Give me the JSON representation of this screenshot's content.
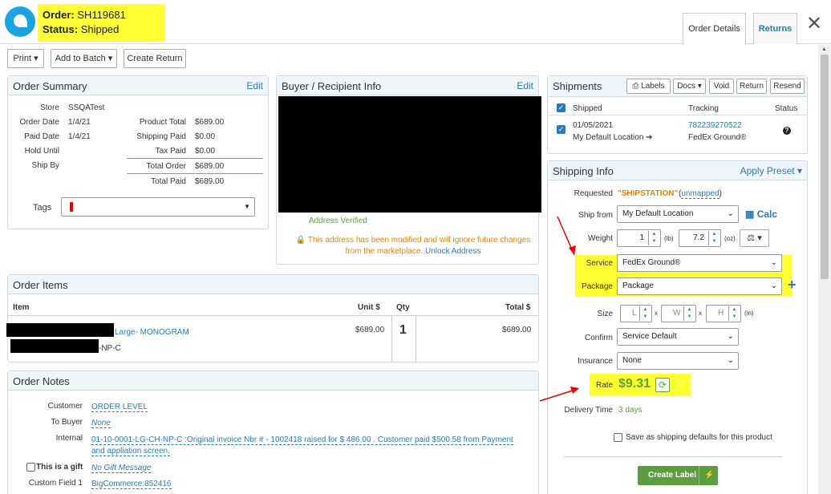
{
  "header": {
    "order_label": "Order:",
    "order_number": "SH119681",
    "status_label": "Status:",
    "status_value": "Shipped",
    "close_glyph": "✕",
    "logo_icon": "shipstation-logo"
  },
  "tabs": [
    {
      "label": "Order Details"
    },
    {
      "label": "Returns"
    }
  ],
  "toolbar": {
    "print": "Print",
    "add_to_batch": "Add to Batch",
    "create_return": "Create Return"
  },
  "order_summary": {
    "title": "Order Summary",
    "edit": "Edit",
    "store_label": "Store",
    "store": "SSQATest",
    "order_date_label": "Order Date",
    "order_date": "1/4/21",
    "paid_date_label": "Paid Date",
    "paid_date": "1/4/21",
    "hold_until_label": "Hold Until",
    "ship_by_label": "Ship By",
    "product_total_label": "Product Total",
    "product_total": "$689.00",
    "shipping_paid_label": "Shipping Paid",
    "shipping_paid": "$0.00",
    "tax_paid_label": "Tax Paid",
    "tax_paid": "$0.00",
    "total_order_label": "Total Order",
    "total_order": "$689.00",
    "total_paid_label": "Total Paid",
    "total_paid": "$689.00",
    "tags_label": "Tags"
  },
  "buyer": {
    "title": "Buyer / Recipient Info",
    "edit": "Edit",
    "verified": "Address Verified",
    "warning": "This address has been modified and will ignore future changes from the marketplace.",
    "unlock": "Unlock Address"
  },
  "order_items": {
    "title": "Order Items",
    "col_item": "Item",
    "col_unit": "Unit $",
    "col_qty": "Qty",
    "col_total": "Total $",
    "item_name_tail": "Large- MONOGRAM",
    "item_sku_tail": "-NP-C",
    "unit": "$689.00",
    "qty": "1",
    "total": "$689.00"
  },
  "order_notes": {
    "title": "Order Notes",
    "customer_label": "Customer",
    "customer": "ORDER LEVEL",
    "to_buyer_label": "To Buyer",
    "to_buyer": "None",
    "internal_label": "Internal",
    "internal": "01-10-0001-LG-CH-NP-C      :Original invoice Nbr # - 1002418 raised for $ 486.00 . Customer paid $500.58 from Payment and appliation screen.",
    "gift_label": "This is a gift",
    "gift": "No Gift Message",
    "custom_label": "Custom Field 1",
    "custom": "BigCommerce:852416"
  },
  "shipments": {
    "title": "Shipments",
    "labels": "Labels",
    "docs": "Docs",
    "void": "Void",
    "return": "Return",
    "resend": "Resend",
    "col_shipped": "Shipped",
    "col_tracking": "Tracking",
    "col_status": "Status",
    "row_date": "01/05/2021",
    "row_location": "My Default Location",
    "tracking": "782239270522",
    "carrier": "FedEx Ground®"
  },
  "shipping_info": {
    "title": "Shipping Info",
    "apply_preset": "Apply Preset",
    "requested_label": "Requested",
    "requested": "\"SHIPSTATION\"",
    "unmapped": "unmapped",
    "ship_from_label": "Ship from",
    "ship_from": "My Default Location",
    "calc": "Calc",
    "weight_label": "Weight",
    "lb": "1",
    "lb_unit": "(lb)",
    "oz": "7.2",
    "oz_unit": "(oz)",
    "service_label": "Service",
    "service": "FedEx Ground®",
    "package_label": "Package",
    "package": "Package",
    "size_label": "Size",
    "size_l": "L",
    "size_w": "W",
    "size_h": "H",
    "size_unit": "(in)",
    "size_x": "x",
    "confirm_label": "Confirm",
    "confirm": "Service Default",
    "insurance_label": "Insurance",
    "insurance": "None",
    "rate_label": "Rate",
    "rate": "$9.31",
    "delivery_label": "Delivery Time",
    "delivery": "3 days",
    "save_defaults": "Save as shipping defaults for this product",
    "create_label": "Create Label"
  },
  "colors": {
    "accent": "#2a7ab8",
    "highlight": "#ffff33",
    "rate_green": "#5aa33a",
    "create_btn": "#5a9e3e"
  }
}
